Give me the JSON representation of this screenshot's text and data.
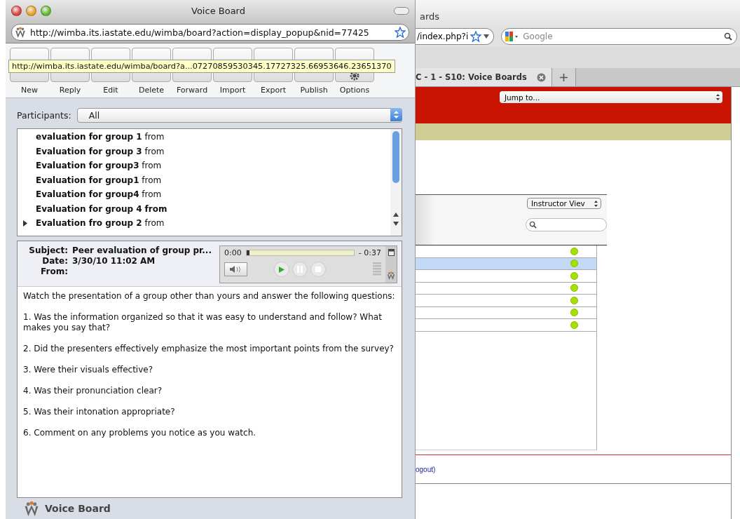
{
  "popup": {
    "title": "Voice Board",
    "url": "http://wimba.its.iastate.edu/wimba/board?action=display_popup&nid=77425",
    "tooltip": "http://wimba.its.iastate.edu/wimba/board?a...07270859530345.17727325.66953646.23651370",
    "toolbar": [
      {
        "label": "New"
      },
      {
        "label": "Reply"
      },
      {
        "label": "Edit"
      },
      {
        "label": "Delete"
      },
      {
        "label": "Forward"
      },
      {
        "label": "Import"
      },
      {
        "label": "Export"
      },
      {
        "label": "Publish"
      },
      {
        "label": "Options"
      }
    ],
    "participants": {
      "label": "Participants:",
      "value": "All"
    },
    "messages": [
      {
        "title": "evaluation for group 1",
        "from": "from",
        "from_bold": false,
        "expandable": false
      },
      {
        "title": "Evaluation for group 3",
        "from": "from",
        "from_bold": false,
        "expandable": false
      },
      {
        "title": "Evaluation for group3",
        "from": "from",
        "from_bold": false,
        "expandable": false
      },
      {
        "title": "Evaluation for group1",
        "from": "from",
        "from_bold": false,
        "expandable": false
      },
      {
        "title": "Evaluation for group4",
        "from": "from",
        "from_bold": false,
        "expandable": false
      },
      {
        "title": "Evaluation for group 4",
        "from": "from",
        "from_bold": true,
        "expandable": false
      },
      {
        "title": "Evaluation fro group 2",
        "from": "from",
        "from_bold": false,
        "expandable": true
      }
    ],
    "message": {
      "fields": [
        {
          "label": "Subject:",
          "value": "Peer evaluation of group pr..."
        },
        {
          "label": "Date:",
          "value": "3/30/10 11:02 AM"
        },
        {
          "label": "From:"
        }
      ],
      "player": {
        "elapsed": "0:00",
        "remaining": "- 0:37",
        "level": 0.02
      },
      "body": [
        "Watch the presentation of a group other than yours and answer the following questions:",
        "1. Was the information organized so that it was easy to understand and follow? What makes you say that?",
        "2. Did the presenters effectively emphasize the most important points from the survey?",
        "3. Were their visuals effective?",
        "4. Was their pronunciation clear?",
        "5. Was their intonation appropriate?",
        "6. Comment on any problems you notice as you watch."
      ]
    },
    "footer": "Voice Board"
  },
  "browser": {
    "title": "ards",
    "url": "/index.php?i",
    "search_placeholder": "Google",
    "tab": "C - 1 - S10: Voice Boards",
    "jump": "Jump to...",
    "view": "Instructor Viev",
    "rows": [
      {
        "selected": false
      },
      {
        "selected": true
      },
      {
        "selected": false
      },
      {
        "selected": false
      },
      {
        "selected": false
      },
      {
        "selected": false
      },
      {
        "selected": false
      }
    ],
    "logout": "ogout)"
  }
}
